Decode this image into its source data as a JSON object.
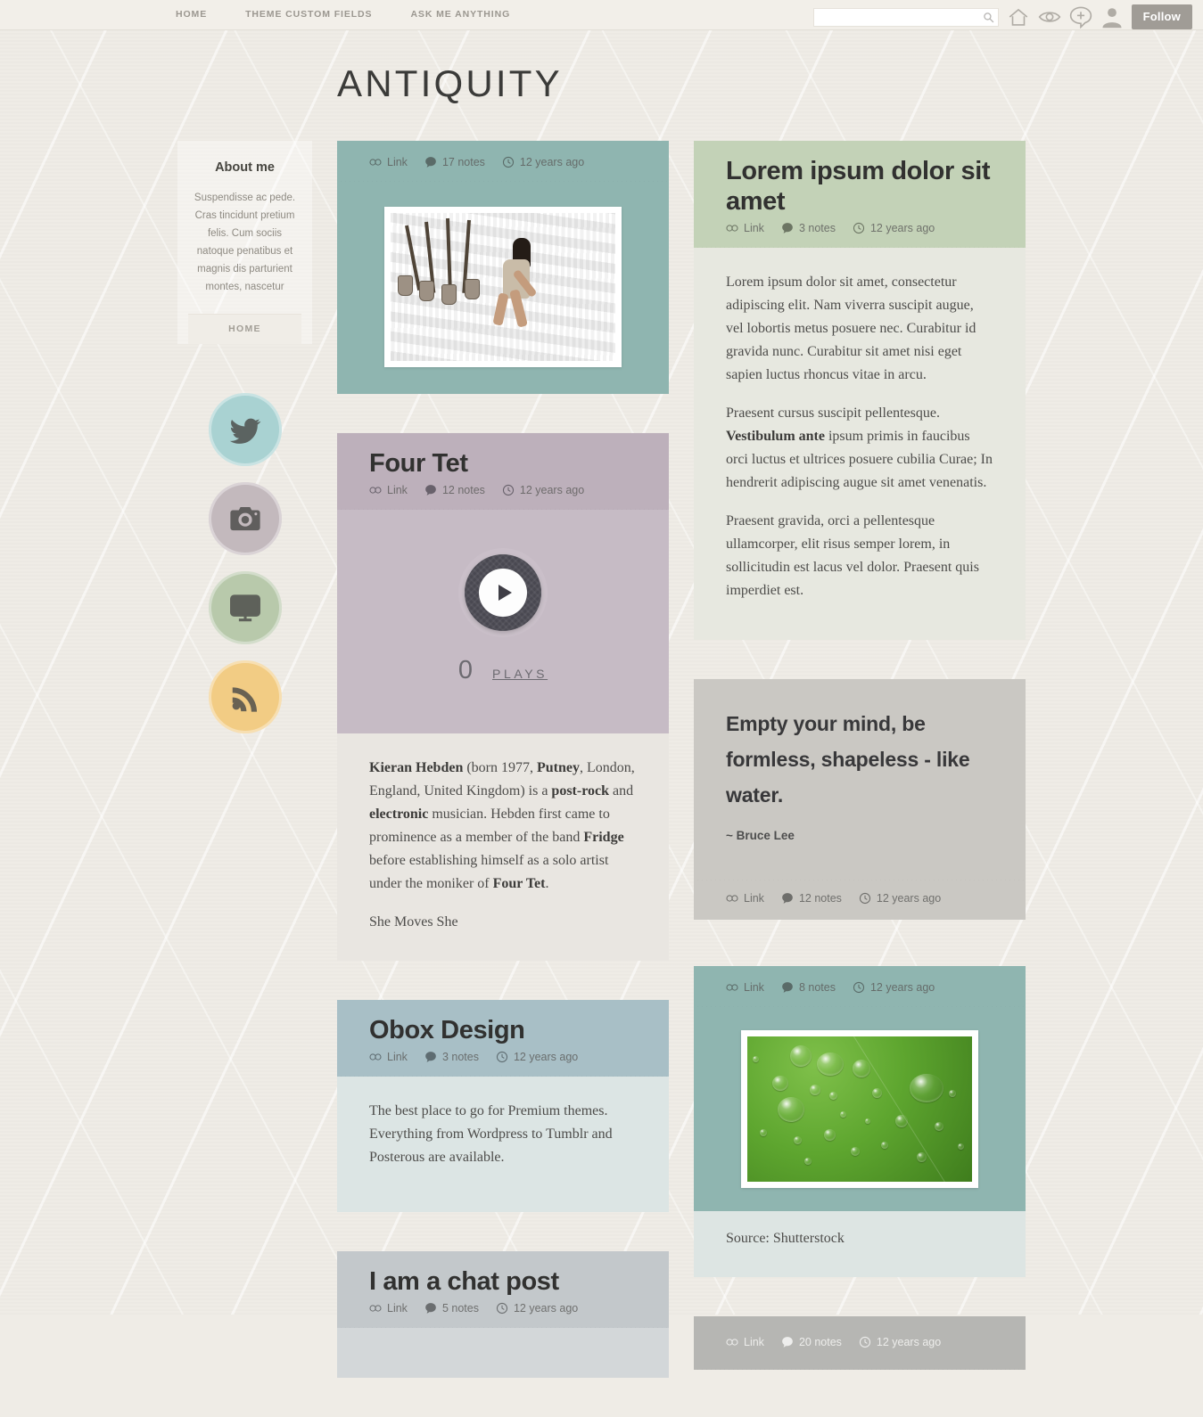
{
  "topnav": {
    "items": [
      {
        "label": "HOME"
      },
      {
        "label": "THEME CUSTOM FIELDS"
      },
      {
        "label": "ASK ME ANYTHING"
      }
    ]
  },
  "controls": {
    "search_value": "",
    "search_placeholder": "",
    "follow_label": "Follow",
    "icons": [
      "search-icon",
      "home-icon",
      "eye-icon",
      "new-post-icon",
      "account-icon"
    ]
  },
  "header": {
    "title": "ANTIQUITY"
  },
  "sidebar": {
    "about_title": "About me",
    "about_text": "Suspendisse ac pede. Cras tincidunt pretium felis. Cum sociis natoque penatibus et magnis dis parturient montes, nascetur",
    "home_label": "HOME",
    "social": [
      {
        "name": "twitter",
        "color": "#a9d2d2"
      },
      {
        "name": "instagram",
        "color": "#c3b9bd"
      },
      {
        "name": "vimeo",
        "color": "#b8c9ab"
      },
      {
        "name": "rss",
        "color": "#f2cc84"
      }
    ]
  },
  "meta_labels": {
    "link": "Link",
    "notes_suffix": "notes"
  },
  "left_column": [
    {
      "id": "photo-quarry",
      "type": "photo",
      "color": "#8fb5b0",
      "body_color": "#8fb5b0",
      "title": "",
      "notes": "17 notes",
      "link": "Link",
      "time": "12 years ago",
      "image": "woman-sitting-with-shovels-photo"
    },
    {
      "id": "audio-four-tet",
      "type": "audio",
      "color": "#bdb0bb",
      "body_color": "#c6bbc5",
      "title": "Four Tet",
      "notes": "12 notes",
      "link": "Link",
      "time": "12 years ago",
      "plays_count": "0",
      "plays_label": "PLAYS",
      "paragraphs": [
        "<b>Kieran Hebden</b> (born 1977, <b>Putney</b>, London, England, United Kingdom) is a <b>post-rock</b> and <b>electronic</b> musician. Hebden first came to prominence as a member of the band <b>Fridge</b> before establishing himself as a solo artist under the moniker of <b>Four Tet</b>.",
        "She Moves She"
      ]
    },
    {
      "id": "link-obox",
      "type": "link",
      "color": "#a8bfc6",
      "body_color": "#dce5e4",
      "title": "Obox Design",
      "notes": "3 notes",
      "link": "Link",
      "time": "12 years ago",
      "paragraphs": [
        "The best place to go for Premium themes. Everything from Wordpress to Tumblr and Posterous are available."
      ]
    },
    {
      "id": "chat-post",
      "type": "chat",
      "color": "#c3c8cb",
      "body_color": "#d3d7d9",
      "title": "I am a chat post",
      "notes": "5 notes",
      "link": "Link",
      "time": "12 years ago",
      "paragraphs": []
    }
  ],
  "right_column": [
    {
      "id": "text-lorem",
      "type": "text",
      "color": "#c3d2b7",
      "body_color": "#e7e8e0",
      "title": "Lorem ipsum dolor sit amet",
      "notes": "3 notes",
      "link": "Link",
      "time": "12 years ago",
      "paragraphs": [
        "Lorem ipsum dolor sit amet, consectetur adipiscing elit. Nam viverra suscipit augue, vel lobortis metus posuere nec. Curabitur id gravida nunc. Curabitur sit amet nisi eget sapien luctus rhoncus vitae in arcu.",
        "Praesent cursus suscipit pellentesque. <b>Vestibulum ante</b> ipsum primis in faucibus orci luctus et ultrices posuere cubilia Curae; In hendrerit adipiscing augue sit amet venenatis.",
        "Praesent gravida, orci a pellentesque ullamcorper, elit risus semper lorem, in sollicitudin est lacus vel dolor. Praesent quis imperdiet est."
      ]
    },
    {
      "id": "quote-bruce-lee",
      "type": "quote",
      "color": "#c7c5c0",
      "body_color": "#cac8c3",
      "quote": "Empty your mind, be formless, shapeless - like water.",
      "source": "~ Bruce Lee",
      "notes": "12 notes",
      "link": "Link",
      "time": "12 years ago"
    },
    {
      "id": "photo-drops",
      "type": "photo",
      "color": "#8fb5b0",
      "body_color": "#dde5e3",
      "title": "",
      "notes": "8 notes",
      "link": "Link",
      "time": "12 years ago",
      "image": "green-leaf-water-drops-photo",
      "caption": "Source: Shutterstock"
    },
    {
      "id": "post-bottom",
      "type": "link",
      "color": "#b6b6b3",
      "body_color": "#c9c9c6",
      "title": "",
      "notes": "20 notes",
      "link": "Link",
      "time": "12 years ago",
      "paragraphs": []
    }
  ]
}
